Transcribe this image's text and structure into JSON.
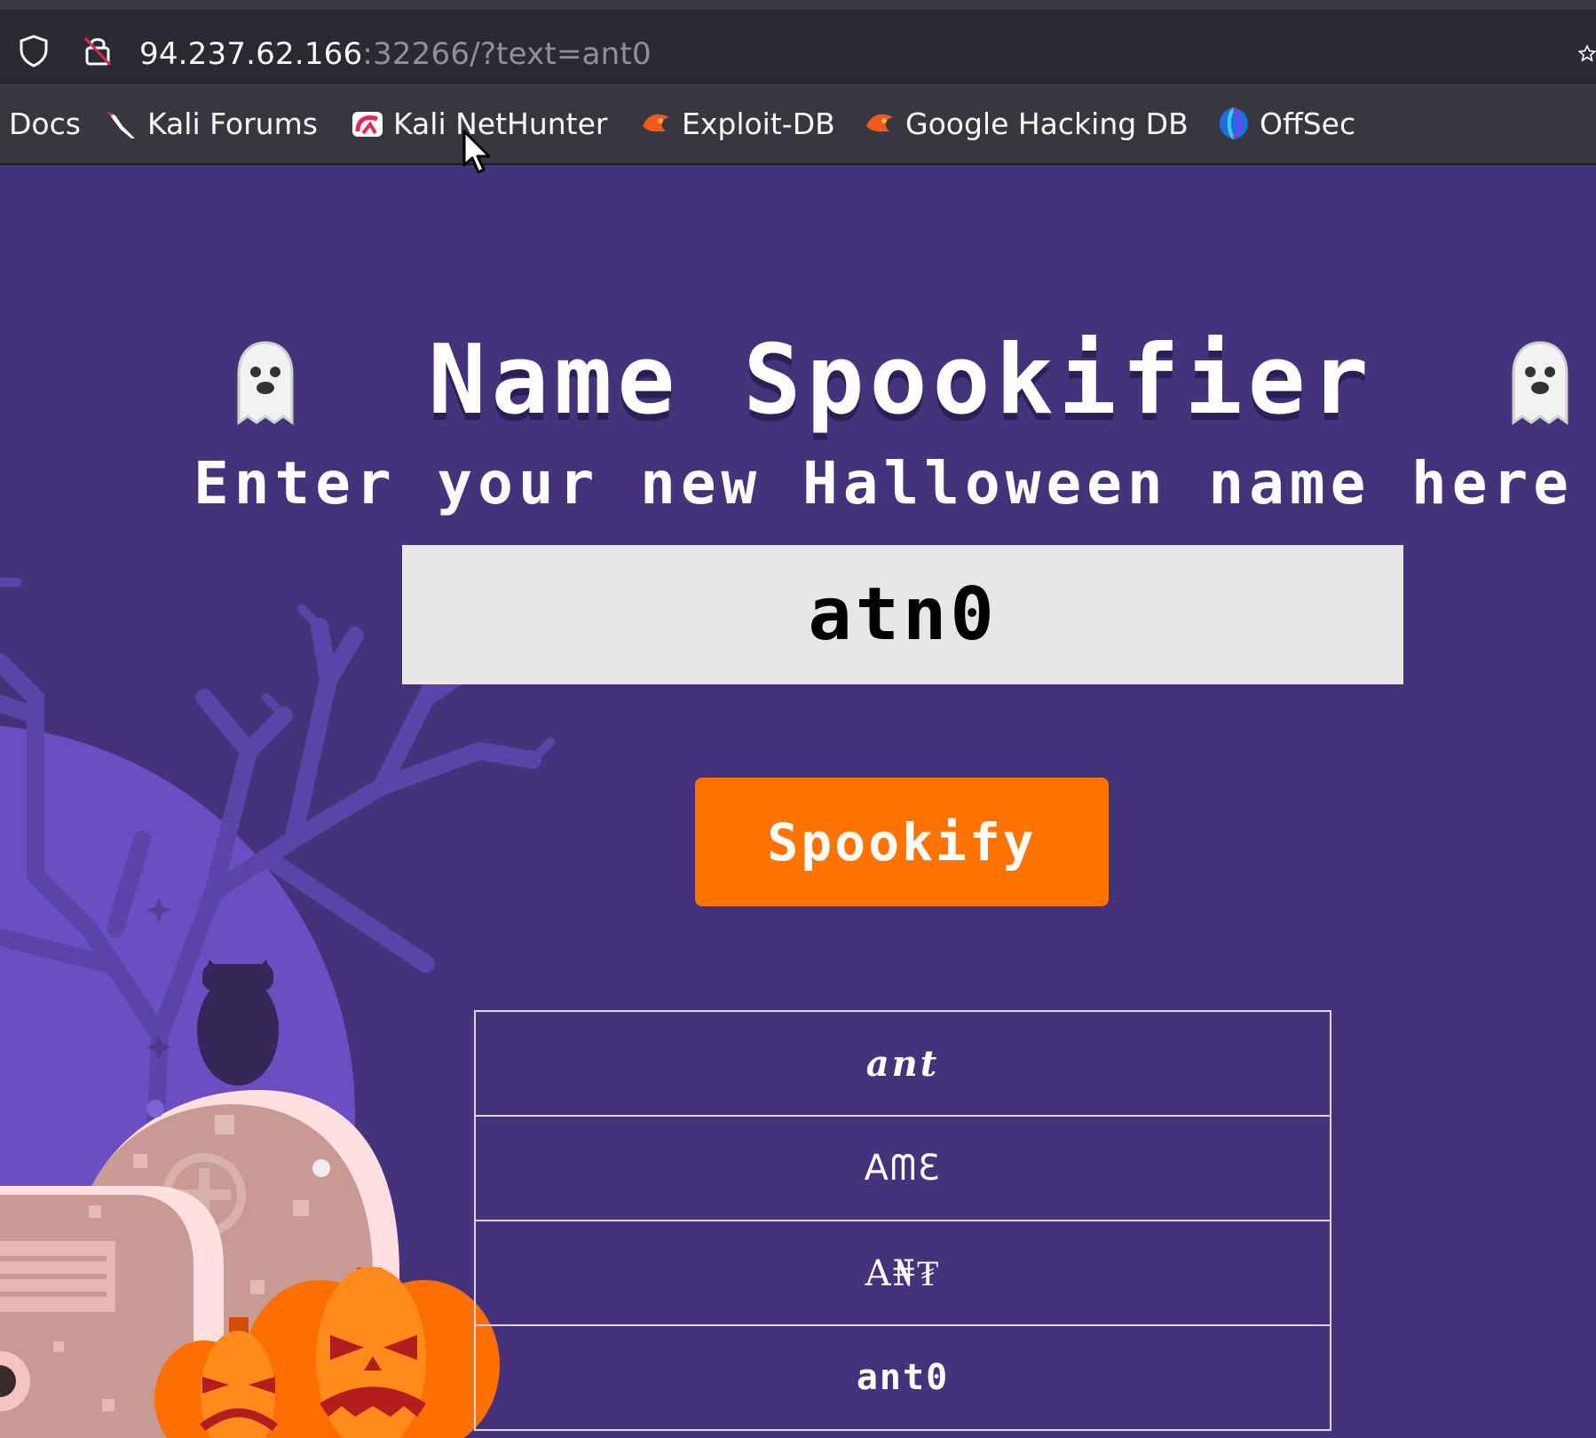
{
  "browser": {
    "url_host": "94.237.62.166",
    "url_rest": ":32266/?text=ant0",
    "bookmarks": [
      {
        "label": "Docs",
        "icon": "kali-docs-icon"
      },
      {
        "label": "Kali Forums",
        "icon": "kali-dragon-icon"
      },
      {
        "label": "Kali NetHunter",
        "icon": "nethunter-icon"
      },
      {
        "label": "Exploit-DB",
        "icon": "exploitdb-icon"
      },
      {
        "label": "Google Hacking DB",
        "icon": "ghdb-icon"
      },
      {
        "label": "OffSec",
        "icon": "offsec-icon"
      }
    ]
  },
  "page": {
    "title": "Name Spookifier",
    "subtitle": "Enter your new Halloween name here",
    "input_value": "atn0",
    "button_label": "Spookify",
    "results": [
      "ant",
      "AᗰƐ",
      "A₦₮",
      "ant0"
    ],
    "accent_color": "#ff7400",
    "background_color": "#44327a"
  }
}
